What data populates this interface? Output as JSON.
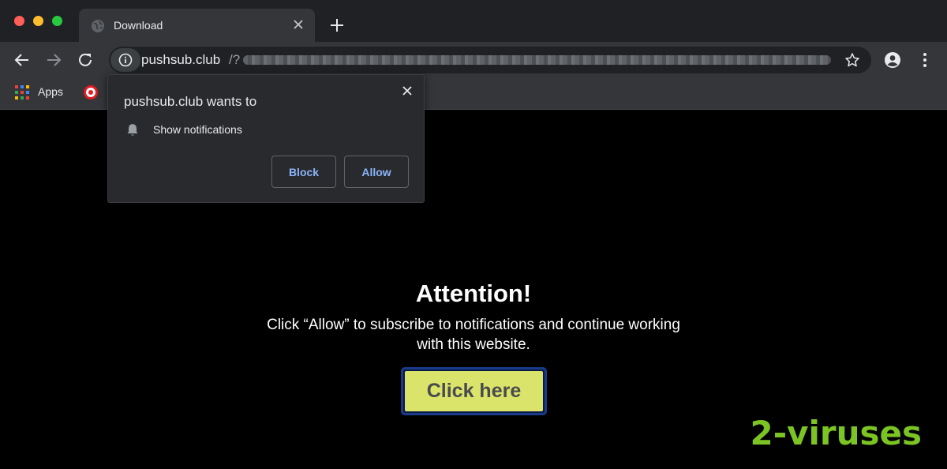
{
  "browser": {
    "tab": {
      "title": "Download"
    },
    "url": {
      "host": "pushsub.club",
      "rest": "/?"
    },
    "bookmarks": [
      {
        "label": "Apps"
      }
    ]
  },
  "popup": {
    "title": "pushsub.club wants to",
    "permission": "Show notifications",
    "block_label": "Block",
    "allow_label": "Allow"
  },
  "page": {
    "heading": "Attention!",
    "message": "Click “Allow” to subscribe to notifications and continue working with this website.",
    "button_label": "Click here"
  },
  "watermark": "2-viruses",
  "colors": {
    "link_blue": "#8ab4f8",
    "cta_yellow": "#dbe46a",
    "watermark_green": "#7cc424"
  }
}
